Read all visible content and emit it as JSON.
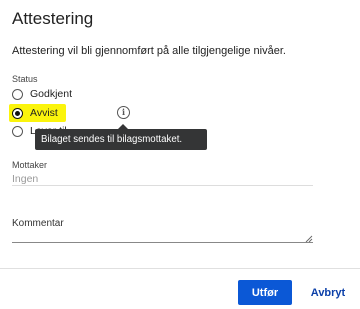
{
  "dialog": {
    "title": "Attestering",
    "description": "Attestering vil bli gjennomført på alle tilgjengelige nivåer."
  },
  "status": {
    "label": "Status",
    "options": [
      {
        "label": "Godkjent",
        "checked": false
      },
      {
        "label": "Avvist",
        "checked": true
      },
      {
        "label": "Lever til ...",
        "checked": false
      }
    ],
    "highlight_color": "#fbf40c"
  },
  "tooltip": {
    "text": "Bilaget sendes til bilagsmottaket."
  },
  "mottaker": {
    "label": "Mottaker",
    "placeholder": "Ingen"
  },
  "kommentar": {
    "label": "Kommentar"
  },
  "actions": {
    "primary_label": "Utfør",
    "secondary_label": "Avbryt",
    "primary_color": "#0b58d6"
  },
  "icons": {
    "info": "info-icon",
    "resize": "resize-handle-icon"
  }
}
